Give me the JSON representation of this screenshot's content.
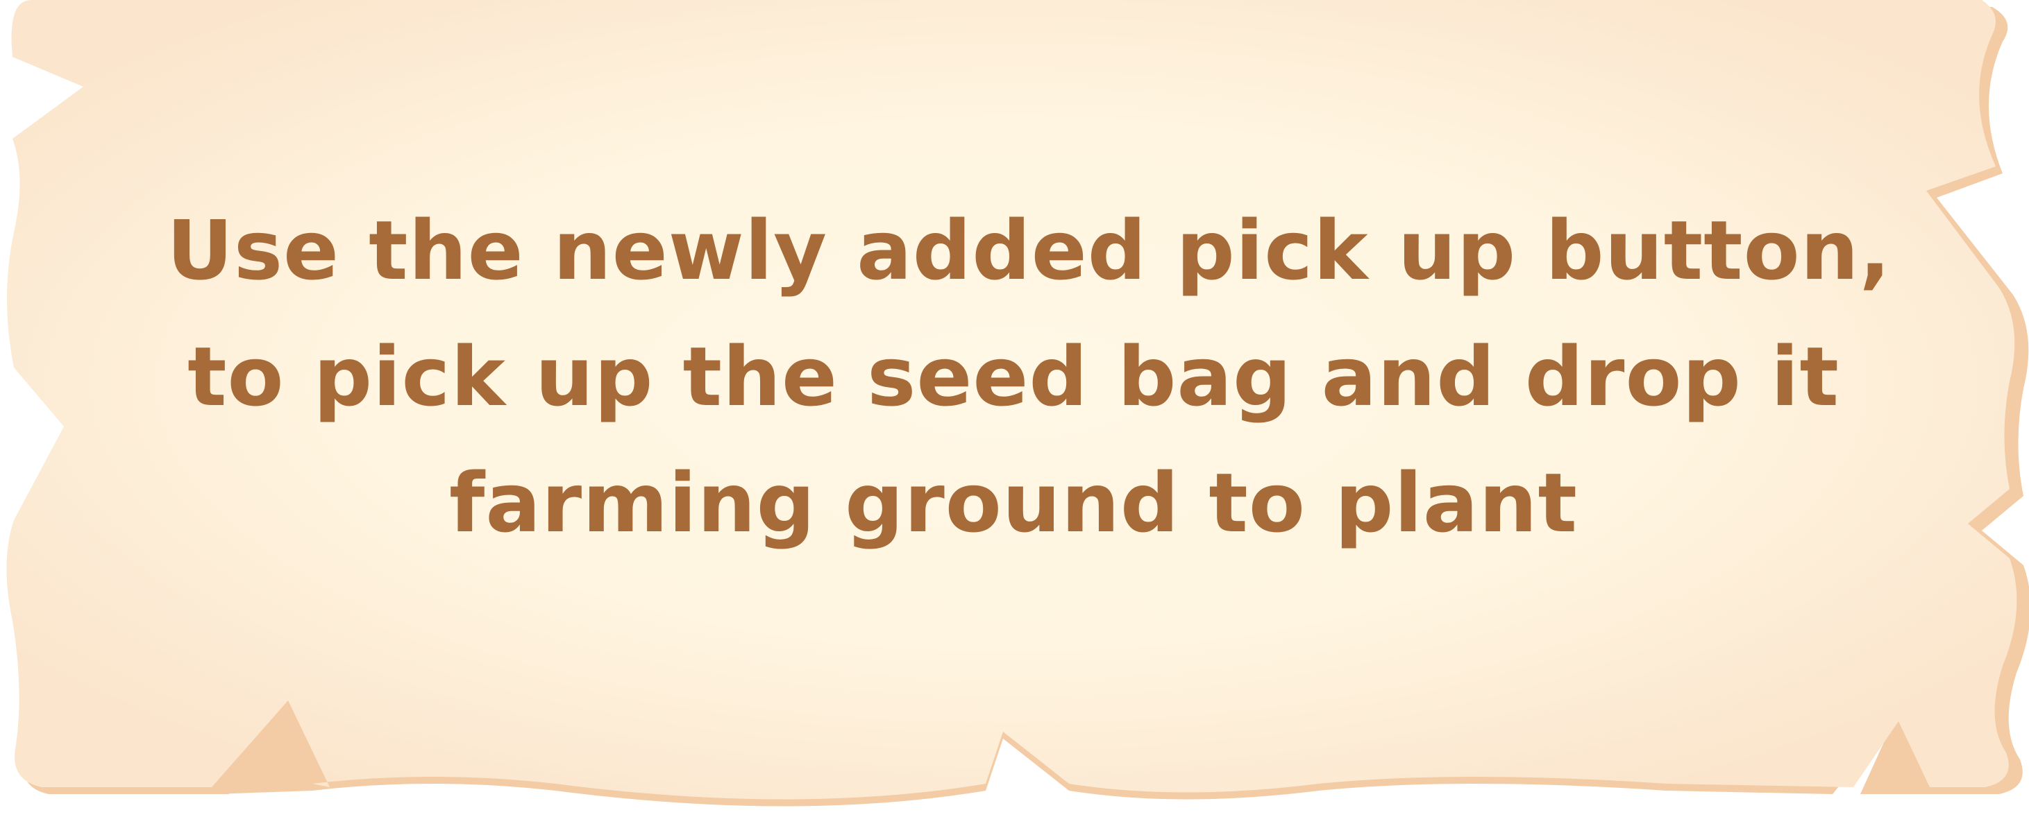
{
  "tutorial": {
    "lines": [
      "Use the newly added pick up button,",
      "to pick up the seed bag and drop it",
      "farming ground to plant"
    ]
  },
  "colors": {
    "parchment_center": "#fff8e6",
    "parchment_edge": "#fbe5cd",
    "parchment_shadow": "#f3cba4",
    "text": "#a66b38"
  }
}
